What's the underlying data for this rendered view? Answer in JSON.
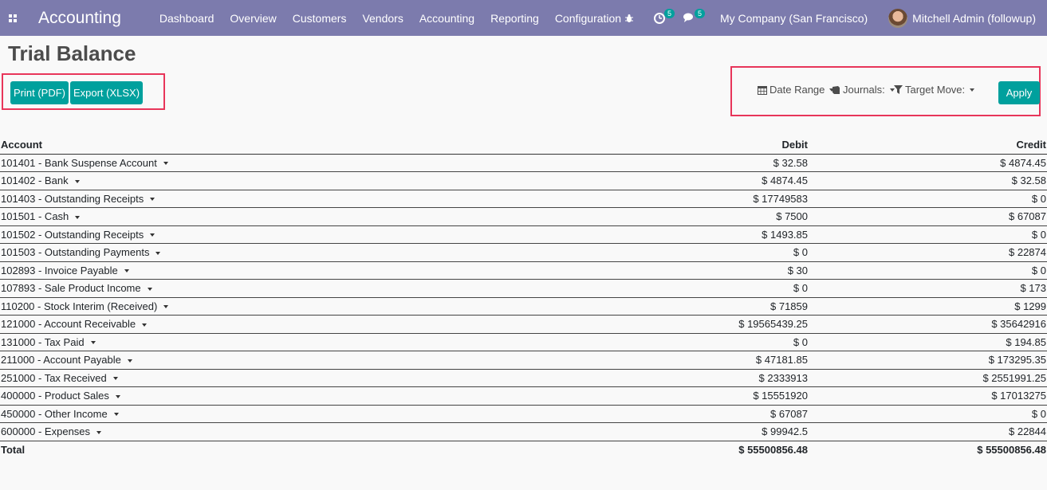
{
  "navbar": {
    "brand": "Accounting",
    "menu": [
      "Dashboard",
      "Overview",
      "Customers",
      "Vendors",
      "Accounting",
      "Reporting",
      "Configuration"
    ],
    "activity_count": "5",
    "messages_count": "5",
    "company": "My Company (San Francisco)",
    "user": "Mitchell Admin (followup)"
  },
  "page": {
    "title": "Trial Balance"
  },
  "actions": {
    "print_label": "Print (PDF)",
    "export_label": "Export (XLSX)"
  },
  "filters": {
    "date_range": "Date Range",
    "journals": "Journals:",
    "target_move": "Target Move:",
    "apply_label": "Apply"
  },
  "table": {
    "headers": {
      "account": "Account",
      "debit": "Debit",
      "credit": "Credit"
    },
    "rows": [
      {
        "account": "101401 - Bank Suspense Account",
        "debit": "$ 32.58",
        "credit": "$ 4874.45"
      },
      {
        "account": "101402 - Bank",
        "debit": "$ 4874.45",
        "credit": "$ 32.58"
      },
      {
        "account": "101403 - Outstanding Receipts",
        "debit": "$ 17749583",
        "credit": "$ 0"
      },
      {
        "account": "101501 - Cash",
        "debit": "$ 7500",
        "credit": "$ 67087"
      },
      {
        "account": "101502 - Outstanding Receipts",
        "debit": "$ 1493.85",
        "credit": "$ 0"
      },
      {
        "account": "101503 - Outstanding Payments",
        "debit": "$ 0",
        "credit": "$ 22874"
      },
      {
        "account": "102893 - Invoice Payable",
        "debit": "$ 30",
        "credit": "$ 0"
      },
      {
        "account": "107893 - Sale Product Income",
        "debit": "$ 0",
        "credit": "$ 173"
      },
      {
        "account": "110200 - Stock Interim (Received)",
        "debit": "$ 71859",
        "credit": "$ 1299"
      },
      {
        "account": "121000 - Account Receivable",
        "debit": "$ 19565439.25",
        "credit": "$ 35642916"
      },
      {
        "account": "131000 - Tax Paid",
        "debit": "$ 0",
        "credit": "$ 194.85"
      },
      {
        "account": "211000 - Account Payable",
        "debit": "$ 47181.85",
        "credit": "$ 173295.35"
      },
      {
        "account": "251000 - Tax Received",
        "debit": "$ 2333913",
        "credit": "$ 2551991.25"
      },
      {
        "account": "400000 - Product Sales",
        "debit": "$ 15551920",
        "credit": "$ 17013275"
      },
      {
        "account": "450000 - Other Income",
        "debit": "$ 67087",
        "credit": "$ 0"
      },
      {
        "account": "600000 - Expenses",
        "debit": "$ 99942.5",
        "credit": "$ 22844"
      }
    ],
    "total": {
      "label": "Total",
      "debit": "$ 55500856.48",
      "credit": "$ 55500856.48"
    }
  }
}
